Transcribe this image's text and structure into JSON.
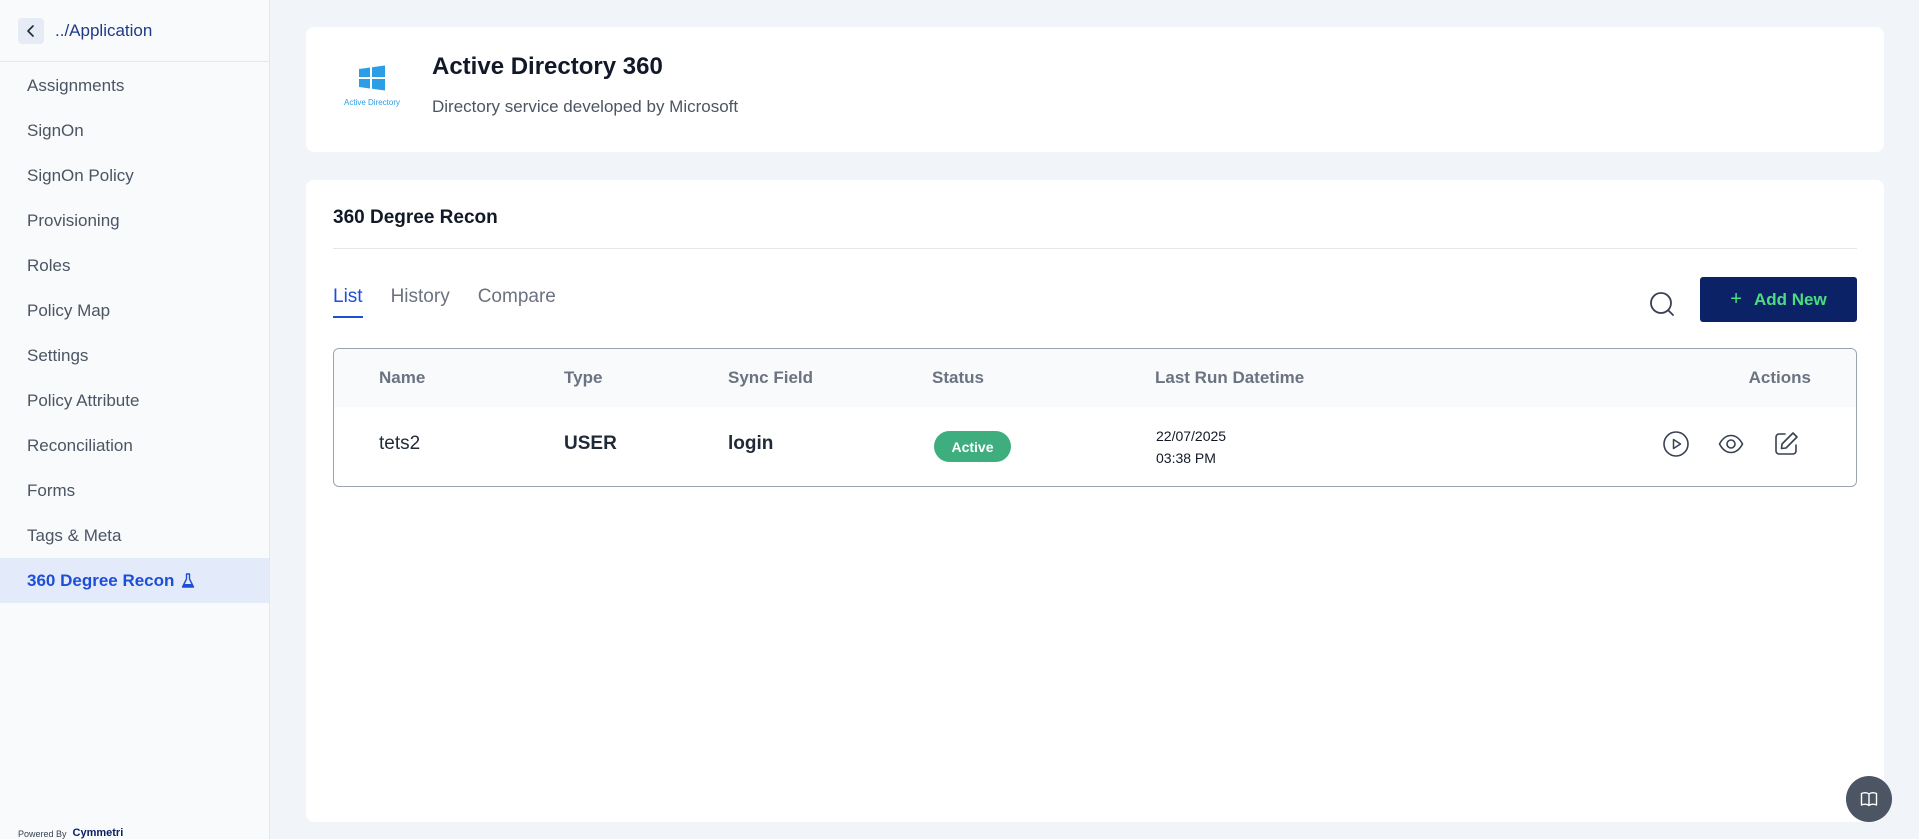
{
  "sidebar": {
    "back_label": "../Application",
    "items": [
      {
        "label": "Assignments"
      },
      {
        "label": "SignOn"
      },
      {
        "label": "SignOn Policy"
      },
      {
        "label": "Provisioning"
      },
      {
        "label": "Roles"
      },
      {
        "label": "Policy Map"
      },
      {
        "label": "Settings"
      },
      {
        "label": "Policy Attribute"
      },
      {
        "label": "Reconciliation"
      },
      {
        "label": "Forms"
      },
      {
        "label": "Tags & Meta"
      },
      {
        "label": "360 Degree Recon"
      }
    ],
    "active_item": "360 Degree Recon",
    "powered_by": "Powered By",
    "brand": "Cymmetri"
  },
  "header": {
    "logo_text": "Active Directory",
    "title": "Active Directory 360",
    "subtitle": "Directory service developed by Microsoft"
  },
  "section": {
    "title": "360 Degree Recon",
    "tabs": [
      {
        "label": "List"
      },
      {
        "label": "History"
      },
      {
        "label": "Compare"
      }
    ],
    "active_tab": "List",
    "add_button": "Add New"
  },
  "table": {
    "columns": [
      "Name",
      "Type",
      "Sync Field",
      "Status",
      "Last Run Datetime",
      "Actions"
    ],
    "rows": [
      {
        "name": "tets2",
        "type": "USER",
        "sync_field": "login",
        "status": "Active",
        "date": "22/07/2025",
        "time": "03:38 PM"
      }
    ]
  },
  "colors": {
    "primary": "#0b2266",
    "accent": "#1d4ed8",
    "status_active": "#3eae7f",
    "add_text": "#4ade80"
  },
  "icons": {
    "back": "chevron-left-icon",
    "flask": "flask-icon",
    "search": "search-icon",
    "run": "play-circle-icon",
    "view": "eye-icon",
    "edit": "edit-icon",
    "help": "book-icon",
    "logo": "windows-logo-icon"
  }
}
